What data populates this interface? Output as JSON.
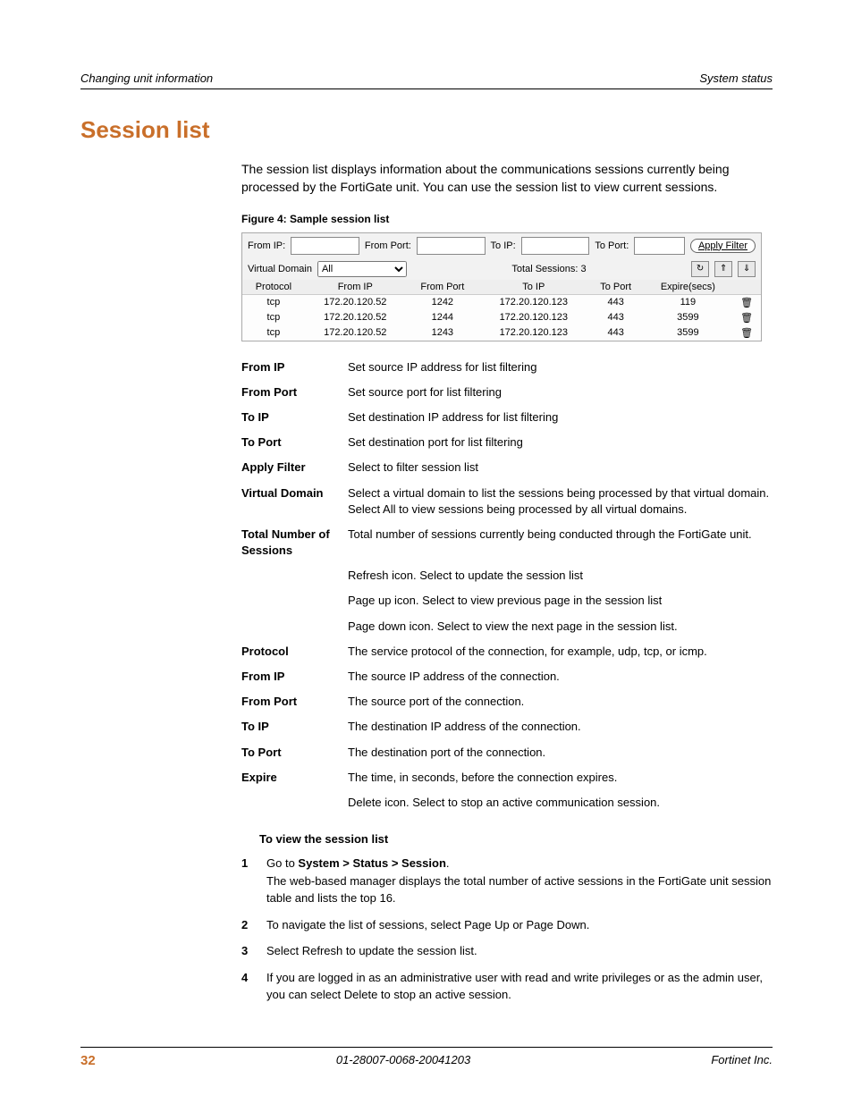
{
  "header": {
    "left": "Changing unit information",
    "right": "System status"
  },
  "title": "Session list",
  "intro": "The session list displays information about the communications sessions currently being processed by the FortiGate unit. You can use the session list to view current sessions.",
  "figure_caption": "Figure 4:   Sample session list",
  "screenshot": {
    "filter": {
      "from_ip_label": "From IP:",
      "from_port_label": "From Port:",
      "to_ip_label": "To IP:",
      "to_port_label": "To Port:",
      "apply_label": "Apply Filter"
    },
    "vd": {
      "label": "Virtual Domain",
      "selected": "All",
      "sessions_label": "Total Sessions: 3"
    },
    "columns": [
      "Protocol",
      "From IP",
      "From Port",
      "To IP",
      "To Port",
      "Expire(secs)",
      ""
    ],
    "rows": [
      {
        "proto": "tcp",
        "fip": "172.20.120.52",
        "fport": "1242",
        "tip": "172.20.120.123",
        "tport": "443",
        "exp": "119"
      },
      {
        "proto": "tcp",
        "fip": "172.20.120.52",
        "fport": "1244",
        "tip": "172.20.120.123",
        "tport": "443",
        "exp": "3599"
      },
      {
        "proto": "tcp",
        "fip": "172.20.120.52",
        "fport": "1243",
        "tip": "172.20.120.123",
        "tport": "443",
        "exp": "3599"
      }
    ]
  },
  "defs": [
    {
      "term": "From IP",
      "desc": "Set source IP address for list filtering"
    },
    {
      "term": "From Port",
      "desc": "Set source port for list filtering"
    },
    {
      "term": "To IP",
      "desc": "Set destination IP address for list filtering"
    },
    {
      "term": "To Port",
      "desc": "Set destination port for list filtering"
    },
    {
      "term": "Apply Filter",
      "desc": "Select to filter session list"
    },
    {
      "term": "Virtual Domain",
      "desc": "Select a virtual domain to list the sessions being processed by that virtual domain. Select All to view sessions being processed by all virtual domains."
    },
    {
      "term": "Total Number of Sessions",
      "desc": "Total number of sessions currently being conducted through the FortiGate unit."
    },
    {
      "term": "",
      "desc": "Refresh icon. Select to update the session list"
    },
    {
      "term": "",
      "desc": "Page up icon. Select to view previous page in the session list"
    },
    {
      "term": "",
      "desc": "Page down icon. Select to view the next page in the session list."
    },
    {
      "term": "Protocol",
      "desc": "The service protocol of the connection, for example, udp, tcp, or icmp."
    },
    {
      "term": "From IP",
      "desc": "The source IP address of the connection."
    },
    {
      "term": "From Port",
      "desc": "The source port of the connection."
    },
    {
      "term": "To IP",
      "desc": "The destination IP address of the connection."
    },
    {
      "term": "To Port",
      "desc": "The destination port of the connection."
    },
    {
      "term": "Expire",
      "desc": "The time, in seconds, before the connection expires."
    },
    {
      "term": "",
      "desc": "Delete icon. Select to stop an active communication session."
    }
  ],
  "subhead": "To view the session list",
  "steps": [
    {
      "n": "1",
      "html": "Go to <b>System &gt; Status &gt; Session</b>.<br>The web-based manager displays the total number of active sessions in the FortiGate unit session table and lists the top 16."
    },
    {
      "n": "2",
      "html": "To navigate the list of sessions, select Page Up or Page Down."
    },
    {
      "n": "3",
      "html": "Select Refresh to update the session list."
    },
    {
      "n": "4",
      "html": "If you are logged in as an administrative user with read and write privileges or as the admin user, you can select Delete to stop an active session."
    }
  ],
  "footer": {
    "page": "32",
    "docid": "01-28007-0068-20041203",
    "company": "Fortinet Inc."
  }
}
